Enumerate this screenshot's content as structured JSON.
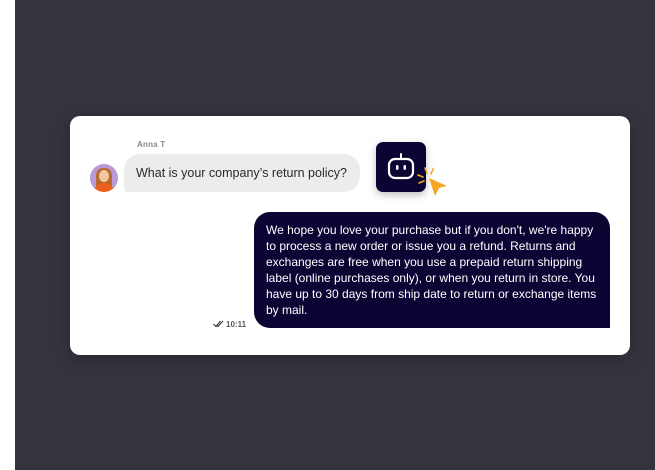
{
  "colors": {
    "background": "#33343d",
    "card": "#ffffff",
    "incoming_bubble": "#ececec",
    "outgoing_bubble": "#0a0533",
    "accent_cursor": "#f5a623"
  },
  "conversation": {
    "incoming": {
      "sender": "Anna T",
      "avatar_icon": "user-avatar",
      "text": "What is your company’s return policy?"
    },
    "bot_button": {
      "icon": "robot-face-icon"
    },
    "cursor": {
      "icon": "click-cursor-icon"
    },
    "outgoing": {
      "text": "We hope you love your purchase but if you don't, we're happy to process a new order or issue you a refund. Returns and exchanges are free when you use a prepaid return shipping label (online purchases only), or when you return in store. You have up to 30 days from ship date to return or exchange items by mail.",
      "time": "10:11",
      "status_icon": "double-check-icon"
    }
  }
}
